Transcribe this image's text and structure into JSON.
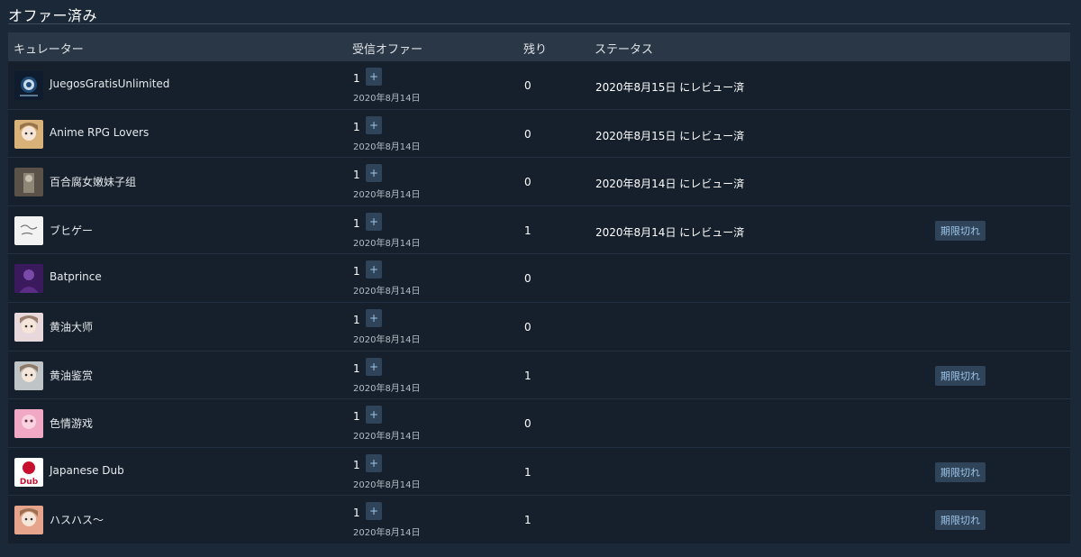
{
  "section_title": "オファー済み",
  "table": {
    "headers": [
      "キュレーター",
      "受信オファー",
      "残り",
      "ステータス"
    ],
    "plus_label": "+",
    "rows": [
      {
        "name": "JuegosGratisUnlimited",
        "avatar_icon": "steam-logo-icon",
        "avatar_bg": "#0e1c2e",
        "offers": "1",
        "date": "2020年8月14日",
        "remaining": "0",
        "status": "2020年8月15日 にレビュー済",
        "badge": ""
      },
      {
        "name": "Anime RPG Lovers",
        "avatar_icon": "anime-girl-icon",
        "avatar_bg": "#d9b27a",
        "offers": "1",
        "date": "2020年8月14日",
        "remaining": "0",
        "status": "2020年8月15日 にレビュー済",
        "badge": ""
      },
      {
        "name": "百合腐女嫩妹子组",
        "avatar_icon": "portrait-icon",
        "avatar_bg": "#5a5248",
        "offers": "1",
        "date": "2020年8月14日",
        "remaining": "0",
        "status": "2020年8月14日 にレビュー済",
        "badge": ""
      },
      {
        "name": "ブヒゲー",
        "avatar_icon": "sketch-icon",
        "avatar_bg": "#f2f2f2",
        "offers": "1",
        "date": "2020年8月14日",
        "remaining": "1",
        "status": "2020年8月14日 にレビュー済",
        "badge": "期限切れ"
      },
      {
        "name": "Batprince",
        "avatar_icon": "purple-character-icon",
        "avatar_bg": "#3a1a5c",
        "offers": "1",
        "date": "2020年8月14日",
        "remaining": "0",
        "status": "",
        "badge": ""
      },
      {
        "name": "黄油大师",
        "avatar_icon": "anime-girl-icon",
        "avatar_bg": "#e8d8dc",
        "offers": "1",
        "date": "2020年8月14日",
        "remaining": "0",
        "status": "",
        "badge": ""
      },
      {
        "name": "黄油鉴赏",
        "avatar_icon": "anime-girl-icon",
        "avatar_bg": "#bfc4c6",
        "offers": "1",
        "date": "2020年8月14日",
        "remaining": "1",
        "status": "",
        "badge": "期限切れ"
      },
      {
        "name": "色情游戏",
        "avatar_icon": "pink-character-icon",
        "avatar_bg": "#f0a8c4",
        "offers": "1",
        "date": "2020年8月14日",
        "remaining": "0",
        "status": "",
        "badge": ""
      },
      {
        "name": "Japanese Dub",
        "avatar_icon": "japan-flag-icon",
        "avatar_bg": "#ffffff",
        "avatar_text": "Dub",
        "offers": "1",
        "date": "2020年8月14日",
        "remaining": "1",
        "status": "",
        "badge": "期限切れ"
      },
      {
        "name": "ハスハス〜",
        "avatar_icon": "anime-girl-icon",
        "avatar_bg": "#e6a48c",
        "offers": "1",
        "date": "2020年8月14日",
        "remaining": "1",
        "status": "",
        "badge": "期限切れ"
      }
    ]
  }
}
